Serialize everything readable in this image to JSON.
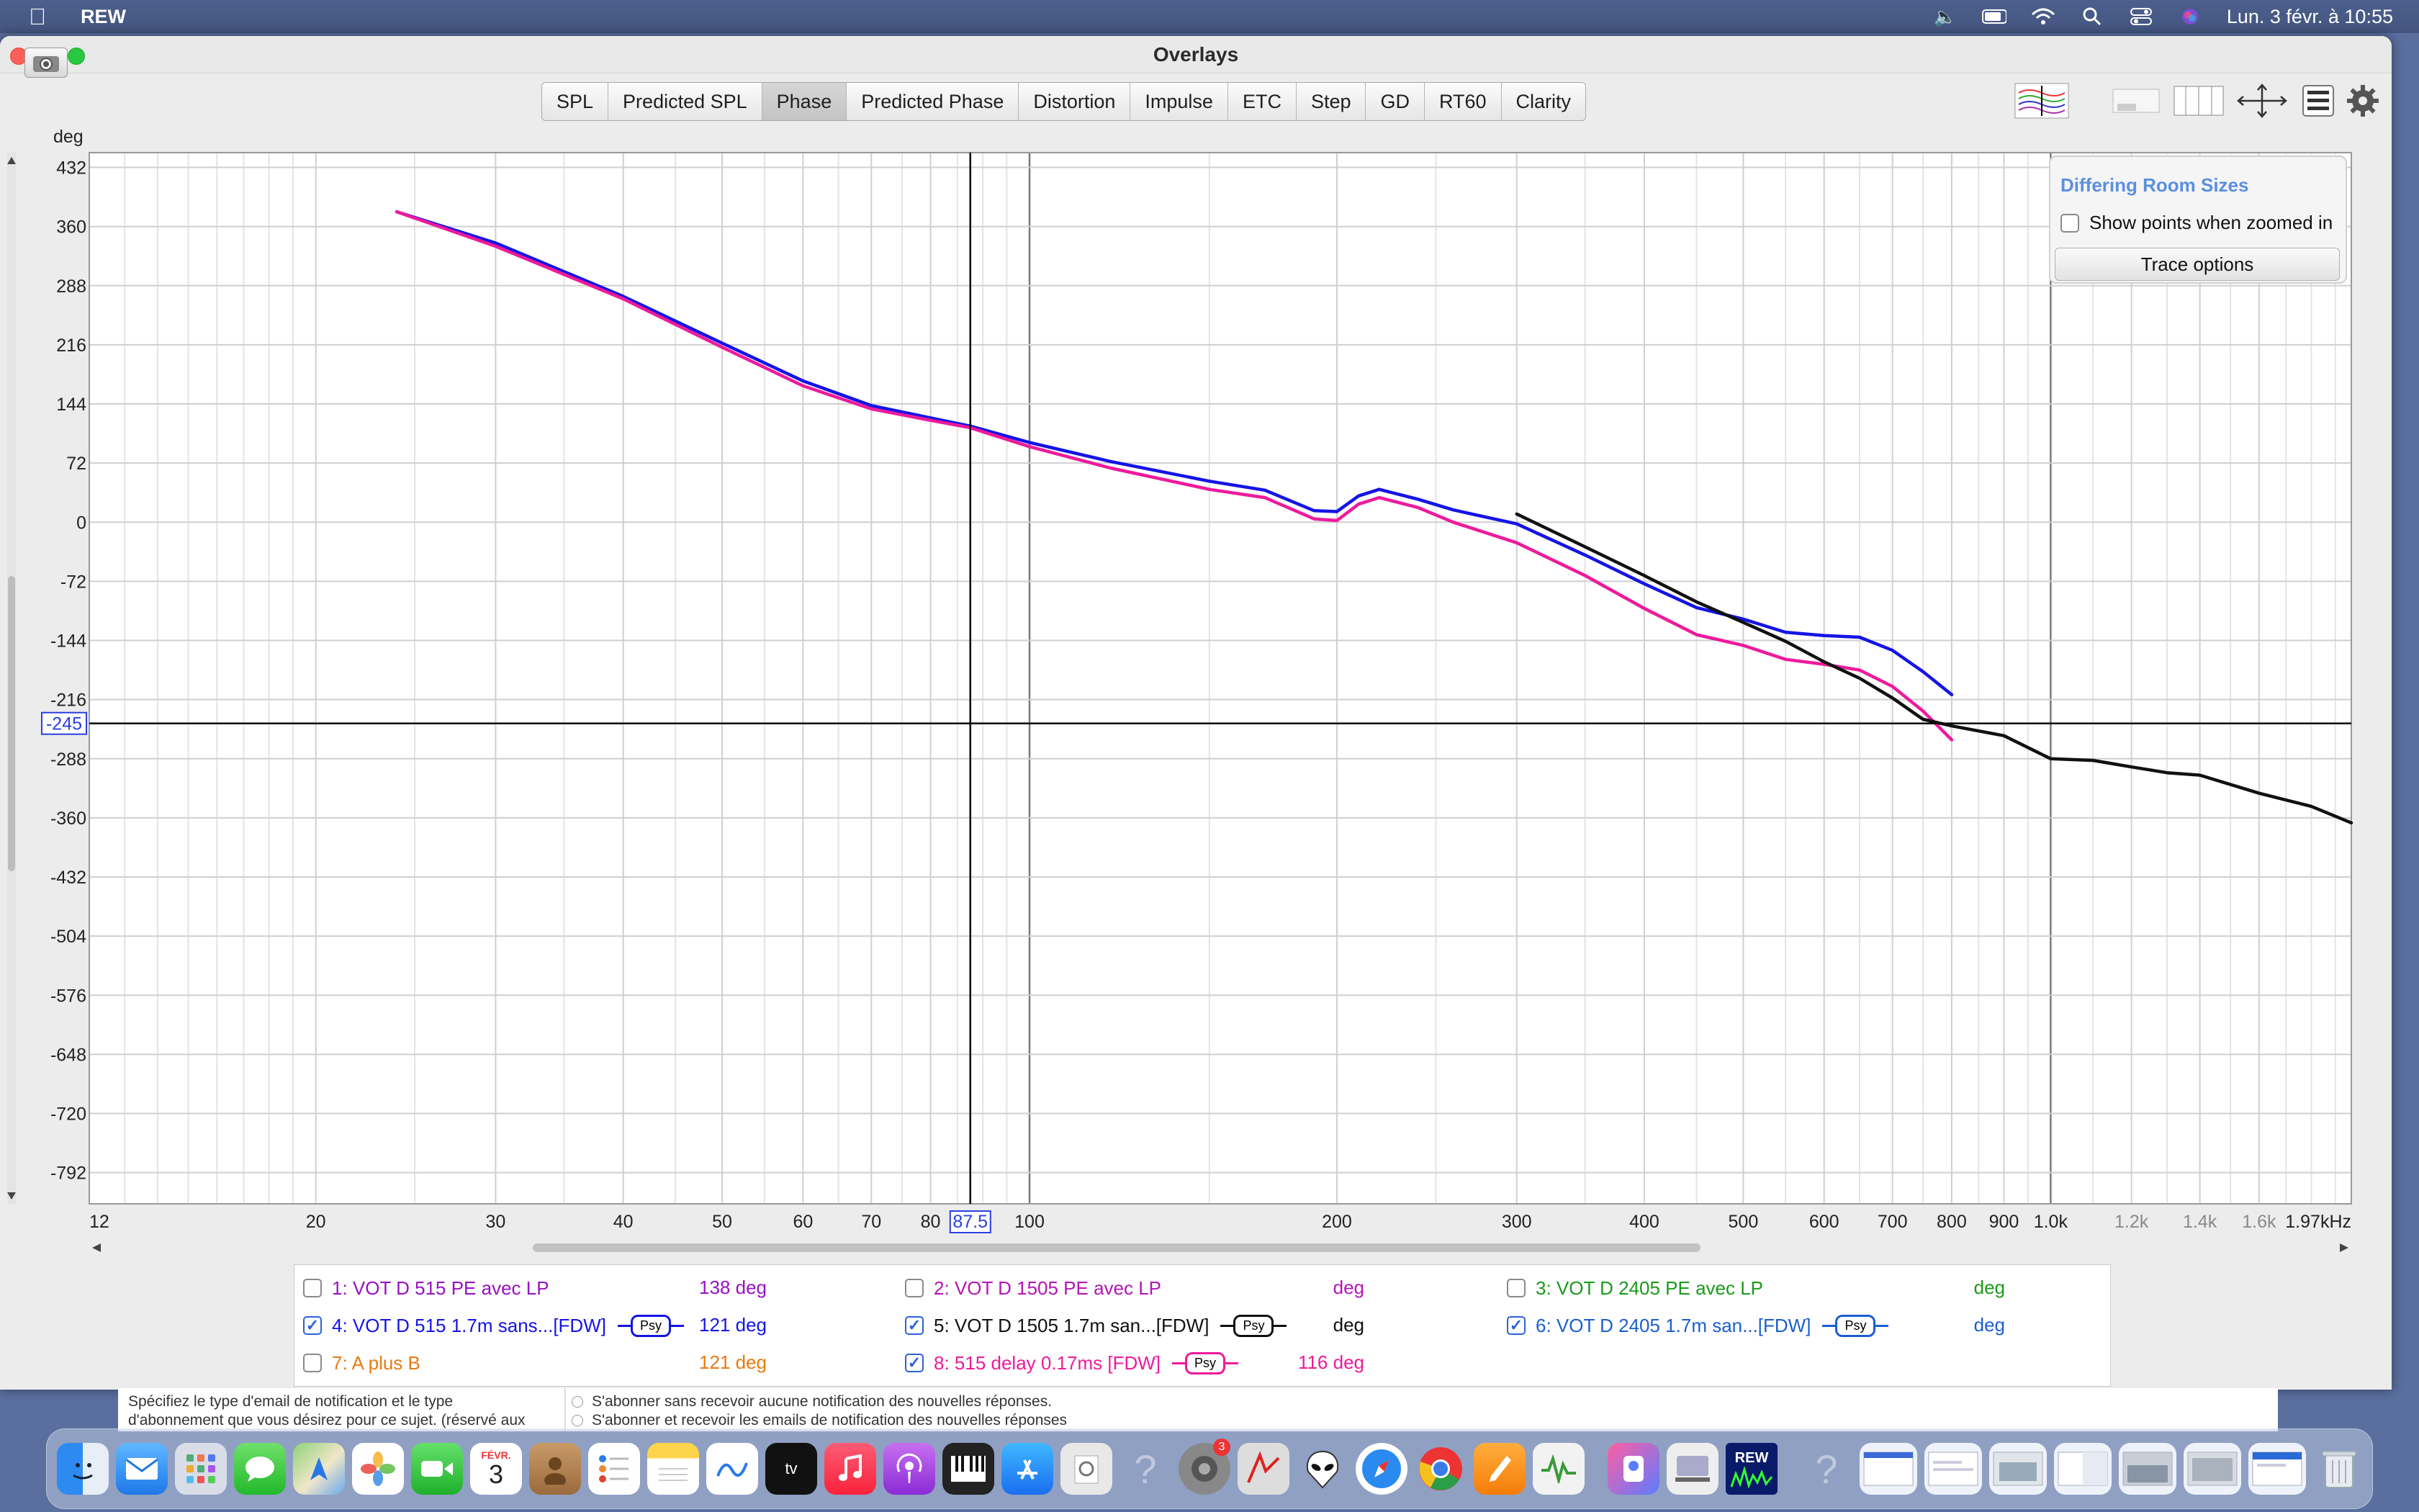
{
  "menubar": {
    "app_name": "REW",
    "datetime": "Lun. 3 févr. à 10:55"
  },
  "window": {
    "title": "Overlays"
  },
  "tabs": [
    {
      "label": "SPL"
    },
    {
      "label": "Predicted SPL"
    },
    {
      "label": "Phase",
      "active": true
    },
    {
      "label": "Predicted Phase"
    },
    {
      "label": "Distortion"
    },
    {
      "label": "Impulse"
    },
    {
      "label": "ETC"
    },
    {
      "label": "Step"
    },
    {
      "label": "GD"
    },
    {
      "label": "RT60"
    },
    {
      "label": "Clarity"
    }
  ],
  "options_panel": {
    "title": "Differing Room Sizes",
    "show_points_label": "Show points when zoomed in",
    "show_points_checked": false,
    "trace_options_label": "Trace options"
  },
  "chart_data": {
    "type": "line",
    "ylabel": "deg",
    "xlabel": "",
    "x_scale": "log",
    "xlim": [
      12,
      1970
    ],
    "ylim": [
      -830,
      450
    ],
    "y_ticks": [
      432,
      360,
      288,
      216,
      144,
      72,
      0,
      -72,
      -144,
      -216,
      -288,
      -360,
      -432,
      -504,
      -576,
      -648,
      -720,
      -792
    ],
    "y_tick_labels": [
      "432",
      "360",
      "288",
      "216",
      "144",
      "72",
      "0",
      "-72",
      "-144",
      "-216",
      "-288",
      "-360",
      "-432",
      "-504",
      "-576",
      "-648",
      "-720",
      "-792"
    ],
    "x_ticks": [
      {
        "value": 12,
        "label": "12",
        "major": false
      },
      {
        "value": 20,
        "label": "20",
        "major": false
      },
      {
        "value": 30,
        "label": "30",
        "major": false
      },
      {
        "value": 40,
        "label": "40",
        "major": false
      },
      {
        "value": 50,
        "label": "50",
        "major": false
      },
      {
        "value": 60,
        "label": "60",
        "major": false
      },
      {
        "value": 70,
        "label": "70",
        "major": false
      },
      {
        "value": 80,
        "label": "80",
        "major": false
      },
      {
        "value": 100,
        "label": "100",
        "major": true
      },
      {
        "value": 200,
        "label": "200",
        "major": false
      },
      {
        "value": 300,
        "label": "300",
        "major": false
      },
      {
        "value": 400,
        "label": "400",
        "major": false
      },
      {
        "value": 500,
        "label": "500",
        "major": false
      },
      {
        "value": 600,
        "label": "600",
        "major": false
      },
      {
        "value": 700,
        "label": "700",
        "major": false
      },
      {
        "value": 800,
        "label": "800",
        "major": false
      },
      {
        "value": 900,
        "label": "900",
        "major": false
      },
      {
        "value": 1000,
        "label": "1.0k",
        "major": true
      },
      {
        "value": 1200,
        "label": "1.2k",
        "major": false,
        "faded": true
      },
      {
        "value": 1400,
        "label": "1.4k",
        "major": false,
        "faded": true
      },
      {
        "value": 1600,
        "label": "1.6k",
        "major": false,
        "faded": true
      },
      {
        "value": 1970,
        "label": "1.97kHz",
        "major": false
      }
    ],
    "minor_grid_x": [
      13,
      14,
      15,
      16,
      17,
      18,
      19,
      25,
      35,
      45,
      55,
      65,
      75,
      85,
      90,
      95,
      150,
      250,
      350,
      450,
      550,
      650,
      750,
      850,
      950,
      1100,
      1300,
      1500,
      1700,
      1800,
      1900
    ],
    "cursor": {
      "x": 87.5,
      "x_label": "87.5",
      "y": -245,
      "y_label": "-245"
    },
    "series": [
      {
        "name": "4: VOT D 515 1.7m sans...[FDW]",
        "color": "#1414e6",
        "points": [
          [
            24,
            378
          ],
          [
            30,
            340
          ],
          [
            40,
            275
          ],
          [
            50,
            218
          ],
          [
            60,
            172
          ],
          [
            70,
            142
          ],
          [
            80,
            127
          ],
          [
            87.5,
            117
          ],
          [
            100,
            97
          ],
          [
            120,
            74
          ],
          [
            150,
            50
          ],
          [
            170,
            39
          ],
          [
            190,
            14
          ],
          [
            200,
            13
          ],
          [
            210,
            32
          ],
          [
            220,
            40
          ],
          [
            240,
            28
          ],
          [
            260,
            15
          ],
          [
            300,
            -2
          ],
          [
            350,
            -40
          ],
          [
            400,
            -75
          ],
          [
            450,
            -104
          ],
          [
            500,
            -118
          ],
          [
            550,
            -134
          ],
          [
            600,
            -138
          ],
          [
            650,
            -140
          ],
          [
            700,
            -156
          ],
          [
            750,
            -182
          ],
          [
            800,
            -210
          ]
        ]
      },
      {
        "name": "8: 515 delay 0.17ms [FDW]",
        "color": "#ee1a9c",
        "points": [
          [
            24,
            378
          ],
          [
            30,
            336
          ],
          [
            40,
            272
          ],
          [
            50,
            213
          ],
          [
            60,
            166
          ],
          [
            70,
            138
          ],
          [
            80,
            124
          ],
          [
            87.5,
            115
          ],
          [
            100,
            92
          ],
          [
            120,
            66
          ],
          [
            150,
            40
          ],
          [
            170,
            30
          ],
          [
            190,
            4
          ],
          [
            200,
            2
          ],
          [
            210,
            22
          ],
          [
            220,
            30
          ],
          [
            240,
            18
          ],
          [
            260,
            0
          ],
          [
            300,
            -25
          ],
          [
            350,
            -65
          ],
          [
            400,
            -105
          ],
          [
            450,
            -137
          ],
          [
            500,
            -150
          ],
          [
            550,
            -167
          ],
          [
            600,
            -173
          ],
          [
            650,
            -180
          ],
          [
            700,
            -200
          ],
          [
            750,
            -230
          ],
          [
            800,
            -265
          ]
        ]
      },
      {
        "name": "5: VOT D 1505 1.7m san...[FDW]",
        "color": "#111111",
        "points": [
          [
            300,
            10
          ],
          [
            350,
            -30
          ],
          [
            400,
            -65
          ],
          [
            450,
            -97
          ],
          [
            500,
            -122
          ],
          [
            550,
            -145
          ],
          [
            600,
            -170
          ],
          [
            650,
            -190
          ],
          [
            700,
            -214
          ],
          [
            750,
            -240
          ],
          [
            800,
            -248
          ],
          [
            900,
            -260
          ],
          [
            1000,
            -288
          ],
          [
            1100,
            -290
          ],
          [
            1200,
            -298
          ],
          [
            1300,
            -305
          ],
          [
            1400,
            -308
          ],
          [
            1600,
            -330
          ],
          [
            1800,
            -346
          ],
          [
            1970,
            -366
          ]
        ]
      }
    ]
  },
  "legend": {
    "rows": [
      {
        "id": 1,
        "label": "1: VOT D 515 PE avec LP",
        "checked": false,
        "value": "138 deg",
        "color": "#9a10c4",
        "psy": false
      },
      {
        "id": 2,
        "label": "2: VOT D 1505 PE avec LP",
        "checked": false,
        "value": "deg",
        "color": "#b514b8",
        "psy": false
      },
      {
        "id": 3,
        "label": "3: VOT D 2405 PE avec LP",
        "checked": false,
        "value": "deg",
        "color": "#1a9a1a",
        "psy": false
      },
      {
        "id": 4,
        "label": "4: VOT D 515 1.7m sans...[FDW]",
        "checked": true,
        "value": "121 deg",
        "color": "#1414e6",
        "psy": true,
        "psy_label": "Psy"
      },
      {
        "id": 5,
        "label": "5: VOT D 1505 1.7m san...[FDW]",
        "checked": true,
        "value": "deg",
        "color": "#111111",
        "psy": true,
        "psy_label": "Psy"
      },
      {
        "id": 6,
        "label": "6: VOT D 2405 1.7m san...[FDW]",
        "checked": true,
        "value": "deg",
        "color": "#1a5fd0",
        "psy": true,
        "psy_label": "Psy"
      },
      {
        "id": 7,
        "label": "7: A plus B",
        "checked": false,
        "value": "121 deg",
        "color": "#e87a10",
        "psy": false
      },
      {
        "id": 8,
        "label": "8: 515 delay 0.17ms [FDW]",
        "checked": true,
        "value": "116 deg",
        "color": "#ee1a9c",
        "psy": true,
        "psy_label": "Psy"
      }
    ]
  },
  "background_forum": {
    "left_text_1": "Spécifiez le type d'email de notification et le type",
    "left_text_2": "d'abonnement que vous désirez pour ce sujet. (réservé aux",
    "option_1": "S'abonner sans recevoir aucune notification des nouvelles réponses.",
    "option_2": "S'abonner et recevoir les emails de notification des nouvelles réponses"
  },
  "dock": {
    "calendar_month": "FÉVR.",
    "calendar_day": "3",
    "rew_label": "REW",
    "badge": "3"
  }
}
